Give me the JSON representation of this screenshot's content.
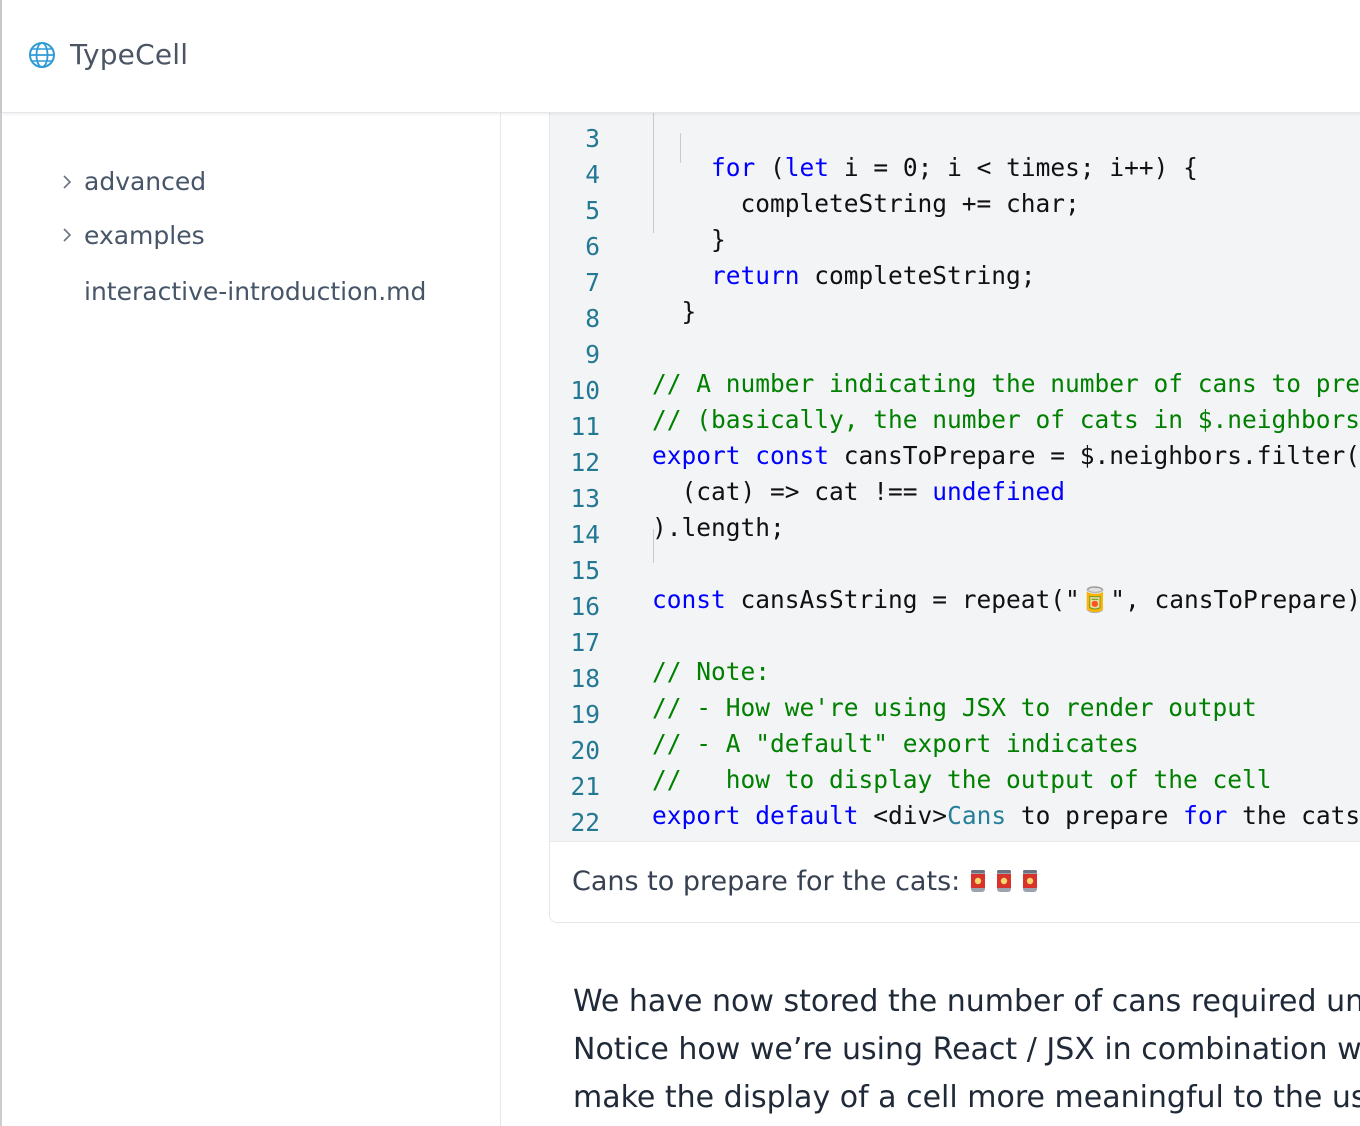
{
  "app": {
    "name": "TypeCell",
    "logo_icon": "globe-icon"
  },
  "sidebar": {
    "items": [
      {
        "label": "advanced",
        "expandable": true
      },
      {
        "label": "examples",
        "expandable": true
      },
      {
        "label": "interactive-introduction.md",
        "expandable": false
      }
    ]
  },
  "code_cell": {
    "lines": [
      {
        "num": "3",
        "code": "    for (let i = 0; i < times; i++) {"
      },
      {
        "num": "4",
        "code": "      completeString += char;"
      },
      {
        "num": "5",
        "code": "    }"
      },
      {
        "num": "6",
        "code": "    return completeString;"
      },
      {
        "num": "7",
        "code": "  }"
      },
      {
        "num": "8",
        "code": ""
      },
      {
        "num": "9",
        "code": "// A number indicating the number of cans to prep"
      },
      {
        "num": "10",
        "code": "// (basically, the number of cats in $.neighbors)"
      },
      {
        "num": "11",
        "code": "export const cansToPrepare = $.neighbors.filter("
      },
      {
        "num": "12",
        "code": "  (cat) => cat !== undefined"
      },
      {
        "num": "13",
        "code": ").length;"
      },
      {
        "num": "14",
        "code": ""
      },
      {
        "num": "15",
        "code": "const cansAsString = repeat(\"🥫\", cansToPrepare);"
      },
      {
        "num": "16",
        "code": ""
      },
      {
        "num": "17",
        "code": "// Note:"
      },
      {
        "num": "18",
        "code": "// - How we're using JSX to render output"
      },
      {
        "num": "19",
        "code": "// - A \"default\" export indicates"
      },
      {
        "num": "20",
        "code": "//   how to display the output of the cell"
      },
      {
        "num": "21",
        "code": "export default <div>Cans to prepare for the cats:"
      },
      {
        "num": "22",
        "code": ""
      }
    ],
    "colors": {
      "keyword": "#0000ff",
      "comment": "#008000",
      "type": "#267f99",
      "line_number": "#237893"
    }
  },
  "output": {
    "text": "Cans to prepare for the cats:",
    "can_count": 3,
    "can_icon": "tin-can-icon"
  },
  "paragraph": {
    "lines": [
      "We have now stored the number of cans required unde",
      "Notice how we’re using React / JSX in combination wit",
      "make the display of a cell more meaningful to the user."
    ]
  }
}
